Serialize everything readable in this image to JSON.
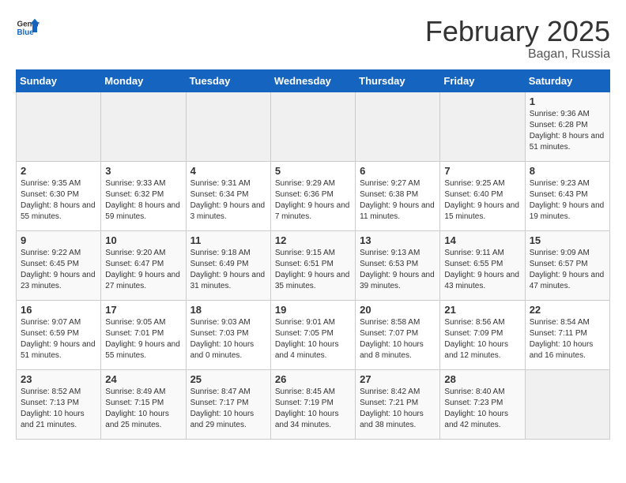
{
  "header": {
    "logo_general": "General",
    "logo_blue": "Blue",
    "month_year": "February 2025",
    "location": "Bagan, Russia"
  },
  "weekdays": [
    "Sunday",
    "Monday",
    "Tuesday",
    "Wednesday",
    "Thursday",
    "Friday",
    "Saturday"
  ],
  "weeks": [
    [
      {
        "empty": true
      },
      {
        "empty": true
      },
      {
        "empty": true
      },
      {
        "empty": true
      },
      {
        "empty": true
      },
      {
        "empty": true
      },
      {
        "day": 1,
        "sunrise": "9:36 AM",
        "sunset": "6:28 PM",
        "daylight": "8 hours and 51 minutes."
      }
    ],
    [
      {
        "day": 2,
        "sunrise": "9:35 AM",
        "sunset": "6:30 PM",
        "daylight": "8 hours and 55 minutes."
      },
      {
        "day": 3,
        "sunrise": "9:33 AM",
        "sunset": "6:32 PM",
        "daylight": "8 hours and 59 minutes."
      },
      {
        "day": 4,
        "sunrise": "9:31 AM",
        "sunset": "6:34 PM",
        "daylight": "9 hours and 3 minutes."
      },
      {
        "day": 5,
        "sunrise": "9:29 AM",
        "sunset": "6:36 PM",
        "daylight": "9 hours and 7 minutes."
      },
      {
        "day": 6,
        "sunrise": "9:27 AM",
        "sunset": "6:38 PM",
        "daylight": "9 hours and 11 minutes."
      },
      {
        "day": 7,
        "sunrise": "9:25 AM",
        "sunset": "6:40 PM",
        "daylight": "9 hours and 15 minutes."
      },
      {
        "day": 8,
        "sunrise": "9:23 AM",
        "sunset": "6:43 PM",
        "daylight": "9 hours and 19 minutes."
      }
    ],
    [
      {
        "day": 9,
        "sunrise": "9:22 AM",
        "sunset": "6:45 PM",
        "daylight": "9 hours and 23 minutes."
      },
      {
        "day": 10,
        "sunrise": "9:20 AM",
        "sunset": "6:47 PM",
        "daylight": "9 hours and 27 minutes."
      },
      {
        "day": 11,
        "sunrise": "9:18 AM",
        "sunset": "6:49 PM",
        "daylight": "9 hours and 31 minutes."
      },
      {
        "day": 12,
        "sunrise": "9:15 AM",
        "sunset": "6:51 PM",
        "daylight": "9 hours and 35 minutes."
      },
      {
        "day": 13,
        "sunrise": "9:13 AM",
        "sunset": "6:53 PM",
        "daylight": "9 hours and 39 minutes."
      },
      {
        "day": 14,
        "sunrise": "9:11 AM",
        "sunset": "6:55 PM",
        "daylight": "9 hours and 43 minutes."
      },
      {
        "day": 15,
        "sunrise": "9:09 AM",
        "sunset": "6:57 PM",
        "daylight": "9 hours and 47 minutes."
      }
    ],
    [
      {
        "day": 16,
        "sunrise": "9:07 AM",
        "sunset": "6:59 PM",
        "daylight": "9 hours and 51 minutes."
      },
      {
        "day": 17,
        "sunrise": "9:05 AM",
        "sunset": "7:01 PM",
        "daylight": "9 hours and 55 minutes."
      },
      {
        "day": 18,
        "sunrise": "9:03 AM",
        "sunset": "7:03 PM",
        "daylight": "10 hours and 0 minutes."
      },
      {
        "day": 19,
        "sunrise": "9:01 AM",
        "sunset": "7:05 PM",
        "daylight": "10 hours and 4 minutes."
      },
      {
        "day": 20,
        "sunrise": "8:58 AM",
        "sunset": "7:07 PM",
        "daylight": "10 hours and 8 minutes."
      },
      {
        "day": 21,
        "sunrise": "8:56 AM",
        "sunset": "7:09 PM",
        "daylight": "10 hours and 12 minutes."
      },
      {
        "day": 22,
        "sunrise": "8:54 AM",
        "sunset": "7:11 PM",
        "daylight": "10 hours and 16 minutes."
      }
    ],
    [
      {
        "day": 23,
        "sunrise": "8:52 AM",
        "sunset": "7:13 PM",
        "daylight": "10 hours and 21 minutes."
      },
      {
        "day": 24,
        "sunrise": "8:49 AM",
        "sunset": "7:15 PM",
        "daylight": "10 hours and 25 minutes."
      },
      {
        "day": 25,
        "sunrise": "8:47 AM",
        "sunset": "7:17 PM",
        "daylight": "10 hours and 29 minutes."
      },
      {
        "day": 26,
        "sunrise": "8:45 AM",
        "sunset": "7:19 PM",
        "daylight": "10 hours and 34 minutes."
      },
      {
        "day": 27,
        "sunrise": "8:42 AM",
        "sunset": "7:21 PM",
        "daylight": "10 hours and 38 minutes."
      },
      {
        "day": 28,
        "sunrise": "8:40 AM",
        "sunset": "7:23 PM",
        "daylight": "10 hours and 42 minutes."
      },
      {
        "empty": true
      }
    ]
  ]
}
